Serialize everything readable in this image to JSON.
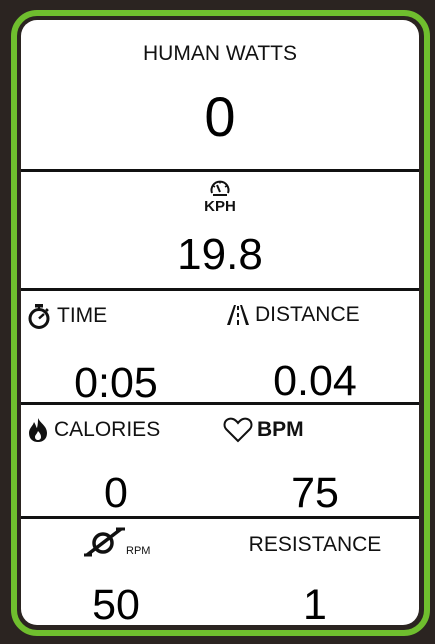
{
  "watts": {
    "label": "HUMAN WATTS",
    "value": "0"
  },
  "speed": {
    "icon": "speedometer-icon",
    "unit": "KPH",
    "value": "19.8"
  },
  "time": {
    "icon": "stopwatch-icon",
    "label": "TIME",
    "value": "0:05"
  },
  "distance": {
    "icon": "road-icon",
    "label": "DISTANCE",
    "value": "0.04"
  },
  "calories": {
    "icon": "flame-icon",
    "label": "CALORIES",
    "value": "0"
  },
  "bpm": {
    "icon": "heart-icon",
    "label": "BPM",
    "value": "75"
  },
  "rpm": {
    "icon": "pedal-rpm-icon",
    "label": "RPM",
    "value": "50"
  },
  "resistance": {
    "label": "RESISTANCE",
    "value": "1"
  },
  "colors": {
    "frame_accent": "#6fbe2e",
    "background": "#2b2421",
    "panel": "#ffffff"
  }
}
